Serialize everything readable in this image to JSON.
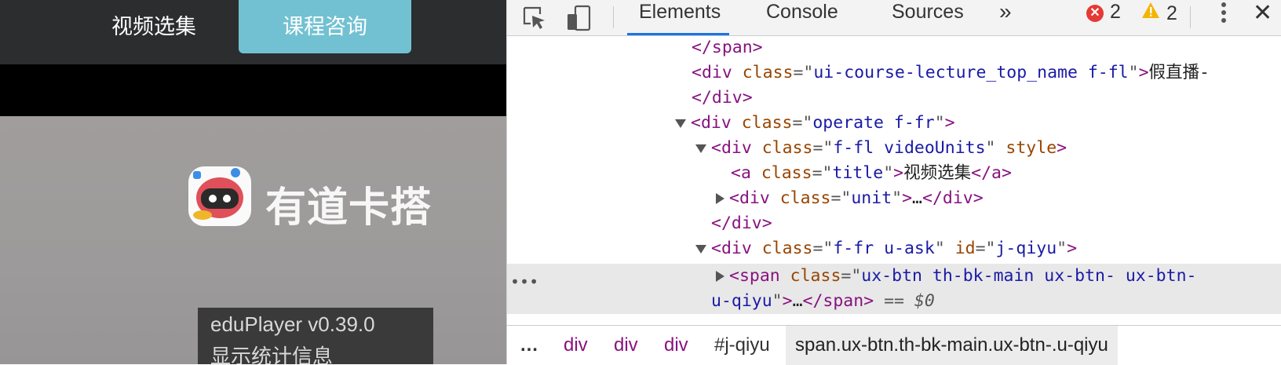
{
  "page": {
    "tabs": {
      "videos": "视频选集",
      "consult": "课程咨询"
    },
    "logo_text": "有道卡搭",
    "player_info": {
      "version": "eduPlayer v0.39.0",
      "stats": "显示统计信息"
    }
  },
  "devtools": {
    "tabs": [
      "Elements",
      "Console",
      "Sources"
    ],
    "more_tabs": "»",
    "errors": "2",
    "warnings": "2",
    "code": {
      "l1_close_span": "</span>",
      "l2_attr_value": "ui-course-lecture_top_name f-fl",
      "l2_text": "假直播-",
      "l3_close_div": "</div>",
      "l4_value": "operate f-fr",
      "l5_value": "f-fl videoUnits",
      "l5_attr2": "style",
      "l6_value": "title",
      "l6_text": "视频选集",
      "l7_value": "unit",
      "l8_close_div": "</div>",
      "l9_value": "f-fr u-ask",
      "l9_id": "j-qiyu",
      "l10_value_a": "ux-btn th-bk-main ux-btn- ux-btn-",
      "l10_value_b": "u-qiyu",
      "l10_suffix": "== $0"
    },
    "breadcrumb": [
      "…",
      "div",
      "div",
      "div",
      "#j-qiyu",
      "span.ux-btn.th-bk-main.ux-btn-.u-qiyu"
    ]
  }
}
